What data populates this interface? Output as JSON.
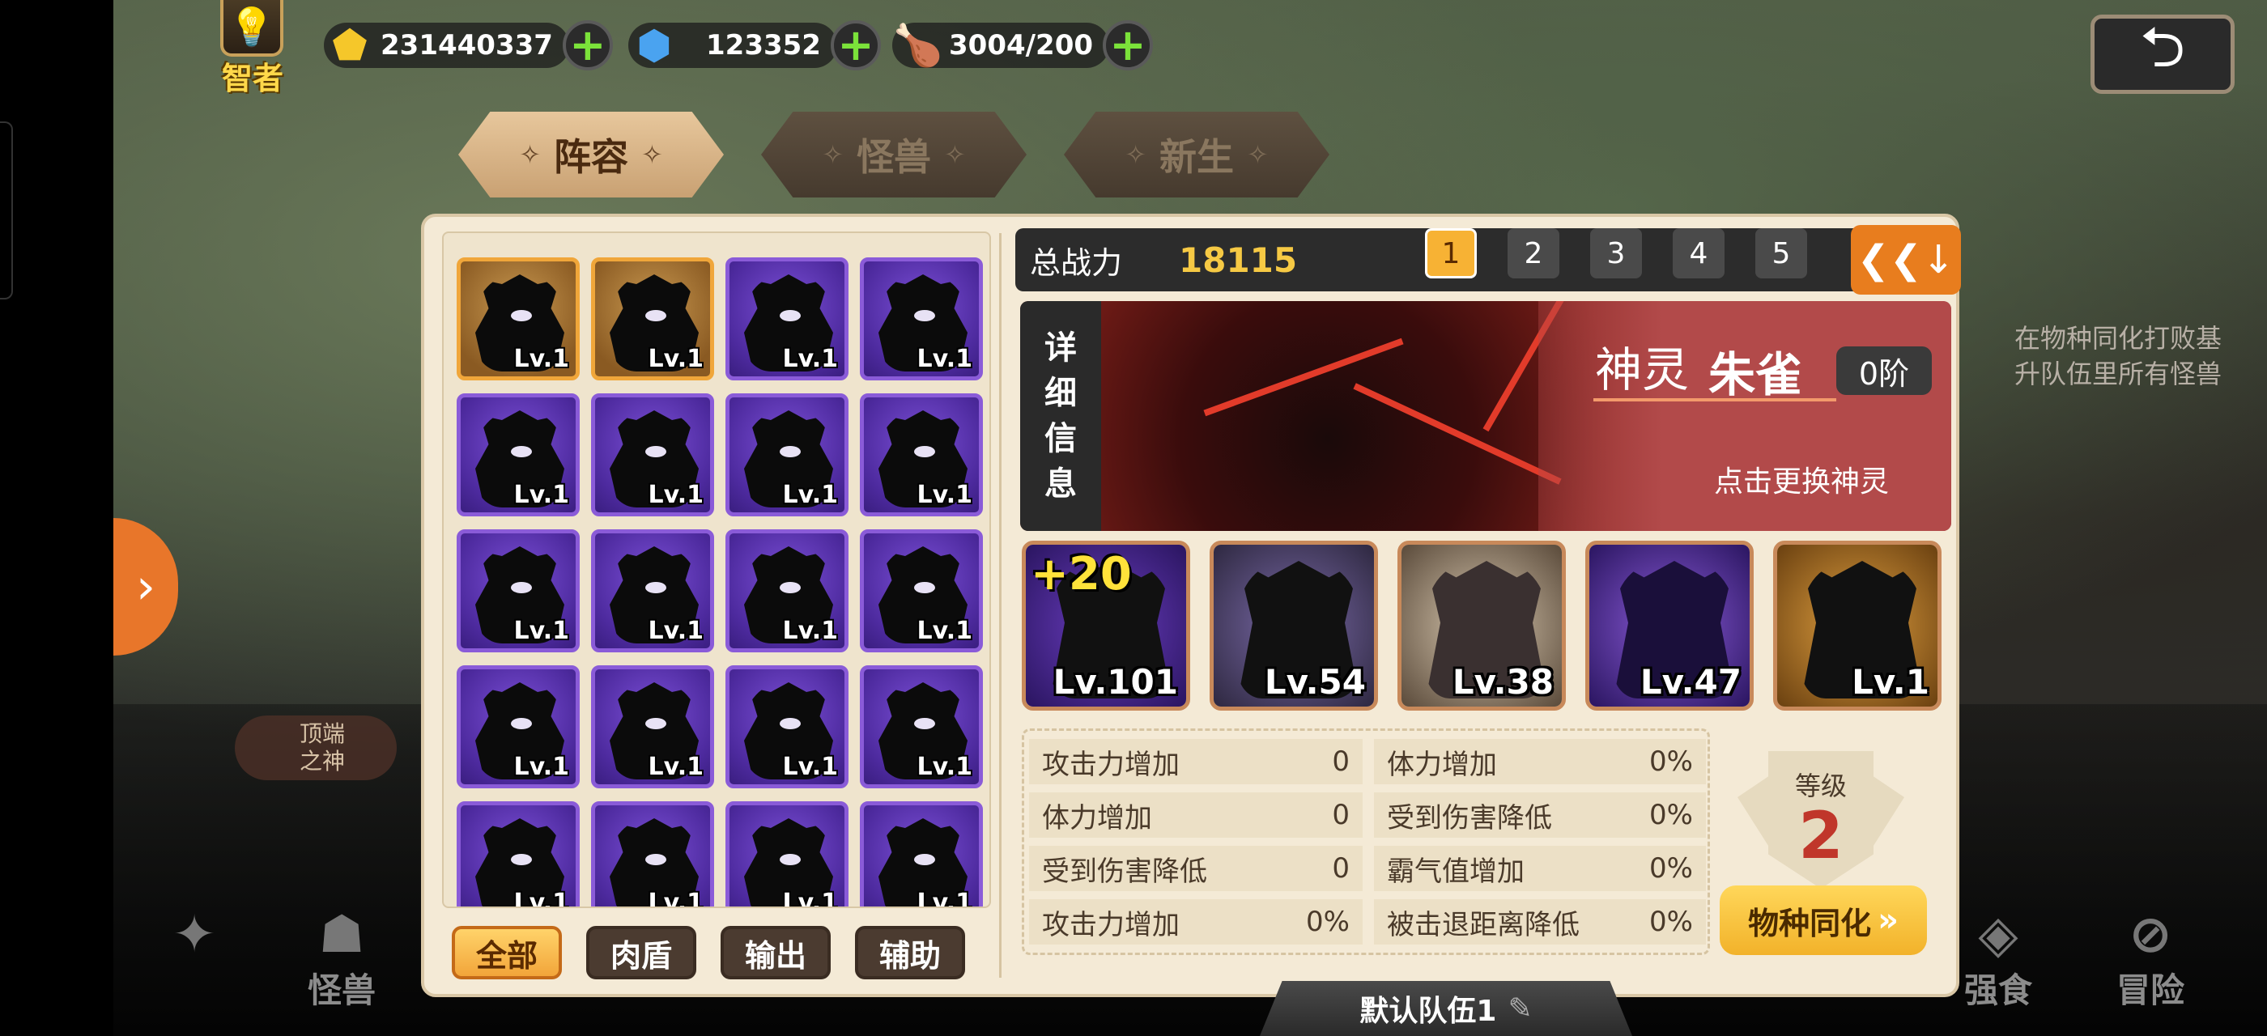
{
  "resources": {
    "wise_label": "智者",
    "gold": "231440337",
    "gems": "123352",
    "stamina": "3004/200"
  },
  "tabs": [
    "阵容",
    "怪兽",
    "新生"
  ],
  "power": {
    "label": "总战力",
    "value": "18115"
  },
  "teams": [
    "1",
    "2",
    "3",
    "4",
    "5"
  ],
  "detail": {
    "tab_chars": [
      "详",
      "细",
      "信",
      "息"
    ],
    "type": "神灵",
    "name": "朱雀",
    "stage": "0阶",
    "hint": "点击更换神灵"
  },
  "team_slots": [
    {
      "plus": "+20",
      "level": "Lv.101"
    },
    {
      "plus": "",
      "level": "Lv.54"
    },
    {
      "plus": "",
      "level": "Lv.38"
    },
    {
      "plus": "",
      "level": "Lv.47"
    },
    {
      "plus": "",
      "level": "Lv.1"
    }
  ],
  "monster_level": "Lv.1",
  "filters": [
    "全部",
    "肉盾",
    "输出",
    "辅助"
  ],
  "stats": {
    "left": [
      {
        "label": "攻击力增加",
        "value": "0"
      },
      {
        "label": "体力增加",
        "value": "0"
      },
      {
        "label": "受到伤害降低",
        "value": "0"
      },
      {
        "label": "攻击力增加",
        "value": "0%"
      }
    ],
    "right": [
      {
        "label": "体力增加",
        "value": "0%"
      },
      {
        "label": "受到伤害降低",
        "value": "0%"
      },
      {
        "label": "霸气值增加",
        "value": "0%"
      },
      {
        "label": "被击退距离降低",
        "value": "0%"
      }
    ]
  },
  "level": {
    "label": "等级",
    "value": "2"
  },
  "assimilate_label": "物种同化",
  "team_name": "默认队伍1",
  "god_badge": [
    "顶端",
    "之神"
  ],
  "right_tip": [
    "在物种同化打败基",
    "升队伍里所有怪兽"
  ],
  "bottom_nav": [
    "怪兽",
    "强食",
    "冒险"
  ]
}
